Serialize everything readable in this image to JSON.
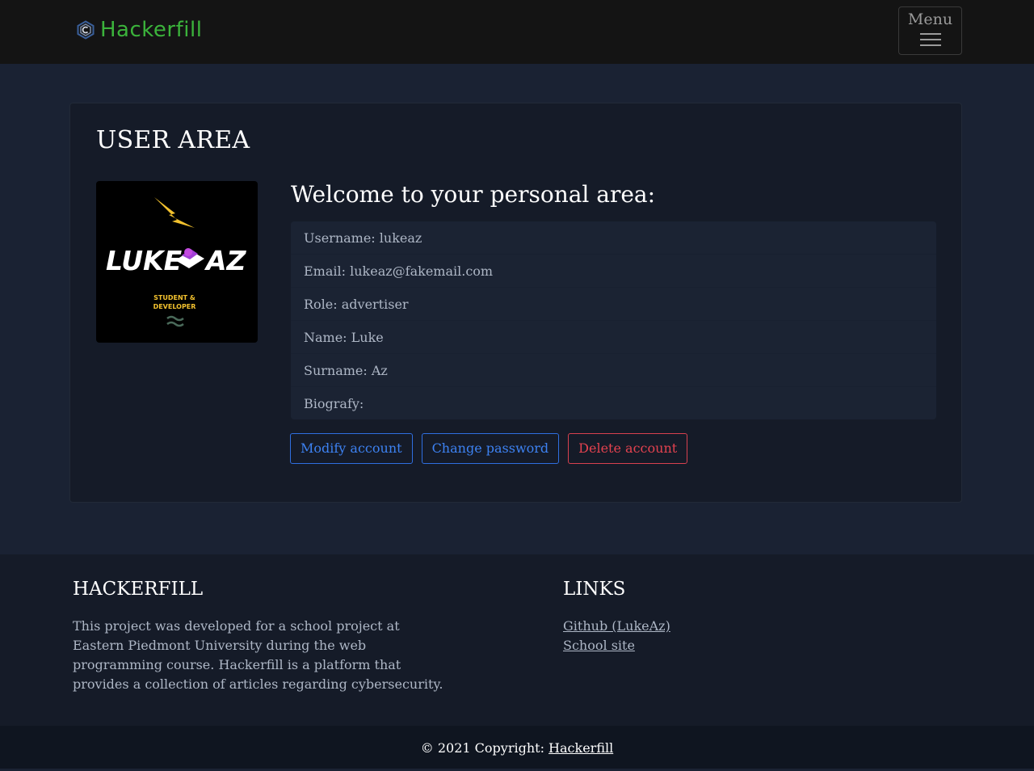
{
  "navbar": {
    "brand_text": "Hackerfill",
    "brand_icon": "hexagon-c-logo-icon",
    "menu_label": "Menu",
    "menu_icon": "hamburger-icon"
  },
  "main": {
    "title": "USER AREA",
    "avatar": {
      "line1": "LUKE",
      "line2": "AZ",
      "tagline1": "STUDENT &",
      "tagline2": "DEVELOPER"
    },
    "welcome": "Welcome to your personal area:",
    "info": [
      {
        "label": "Username: lukeaz"
      },
      {
        "label": "Email: lukeaz@fakemail.com"
      },
      {
        "label": "Role: advertiser"
      },
      {
        "label": "Name: Luke"
      },
      {
        "label": "Surname: Az"
      },
      {
        "label": "Biografy:"
      }
    ],
    "actions": {
      "modify": "Modify account",
      "change_password": "Change password",
      "delete": "Delete account"
    }
  },
  "footer": {
    "about_title": "HACKERFILL",
    "about_text": "This project was developed for a school project at Eastern Piedmont University during the web programming course. Hackerfill is a platform that provides a collection of articles regarding cybersecurity.",
    "links_title": "LINKS",
    "links": [
      {
        "label": "Github (LukeAz)"
      },
      {
        "label": "School site"
      }
    ]
  },
  "copyright": {
    "prefix": "© 2021 Copyright: ",
    "link": "Hackerfill"
  },
  "colors": {
    "brand": "#3bb33b",
    "primary": "#3d82f2",
    "danger": "#e3424f",
    "background": "#1a2233"
  }
}
